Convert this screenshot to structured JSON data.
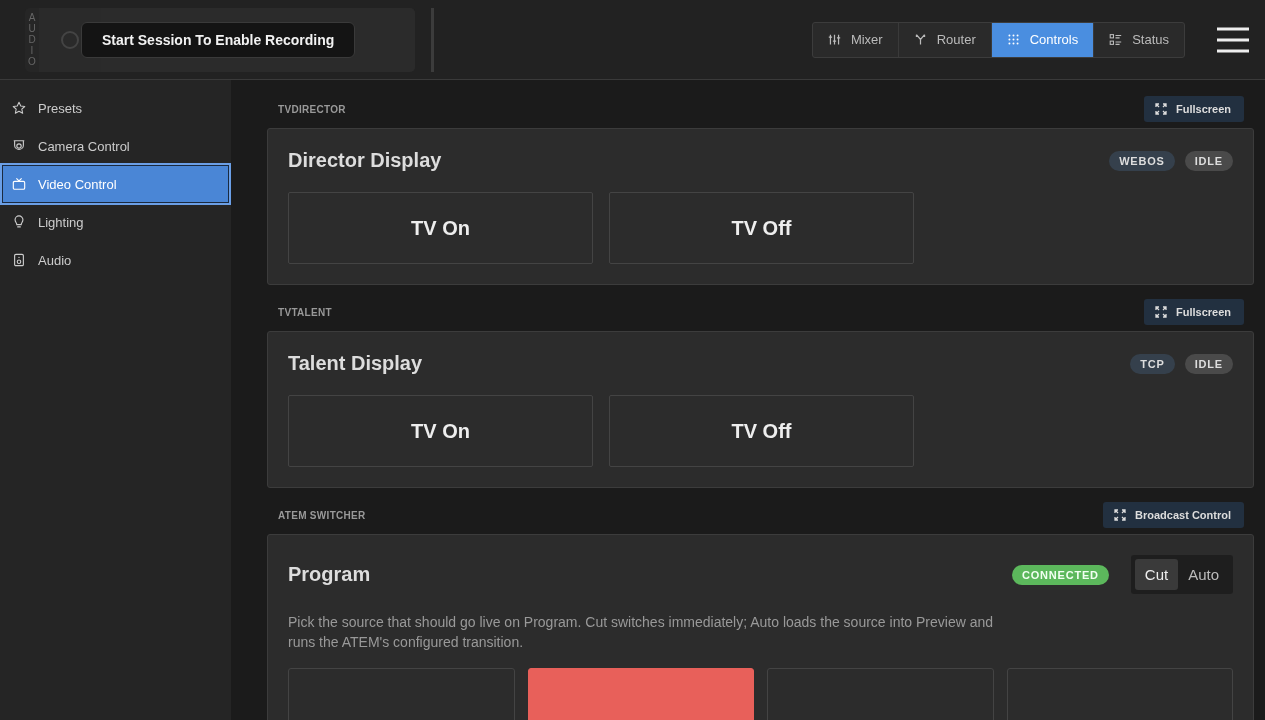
{
  "recorder": {
    "side_label": "AUDIO",
    "tooltip": "Start Session To Enable Recording"
  },
  "nav_tabs": [
    {
      "label": "Mixer",
      "kind": "sliders",
      "selected": false
    },
    {
      "label": "Router",
      "kind": "router",
      "selected": false
    },
    {
      "label": "Controls",
      "kind": "grid",
      "selected": true
    },
    {
      "label": "Status",
      "kind": "list",
      "selected": false
    }
  ],
  "sidebar": {
    "items": [
      {
        "label": "Presets",
        "kind": "star",
        "selected": false
      },
      {
        "label": "Camera Control",
        "kind": "camera",
        "selected": false
      },
      {
        "label": "Video Control",
        "kind": "tv",
        "selected": true
      },
      {
        "label": "Lighting",
        "kind": "bulb",
        "selected": false
      },
      {
        "label": "Audio",
        "kind": "speaker",
        "selected": false
      }
    ]
  },
  "sections": [
    {
      "label": "TVDIRECTOR",
      "action": "Fullscreen",
      "kind": "display",
      "title": "Director Display",
      "badges": [
        {
          "text": "WEBOS",
          "kind": "protocol"
        },
        {
          "text": "IDLE",
          "kind": "state"
        }
      ],
      "buttons": [
        "TV On",
        "TV Off"
      ]
    },
    {
      "label": "TVTALENT",
      "action": "Fullscreen",
      "kind": "display",
      "title": "Talent Display",
      "badges": [
        {
          "text": "TCP",
          "kind": "protocol"
        },
        {
          "text": "IDLE",
          "kind": "state"
        }
      ],
      "buttons": [
        "TV On",
        "TV Off"
      ]
    },
    {
      "label": "ATEM SWITCHER",
      "action": "Broadcast Control",
      "kind": "switcher",
      "title": "Program",
      "badges": [
        {
          "text": "CONNECTED",
          "kind": "ok"
        }
      ],
      "modes": [
        {
          "label": "Cut",
          "selected": true
        },
        {
          "label": "Auto",
          "selected": false
        }
      ],
      "description": "Pick the source that should go live on Program. Cut switches immediately; Auto loads the source into Preview and runs the ATEM's configured transition.",
      "sources": [
        {
          "selected": false
        },
        {
          "selected": true
        },
        {
          "selected": false
        },
        {
          "selected": false
        }
      ]
    }
  ]
}
